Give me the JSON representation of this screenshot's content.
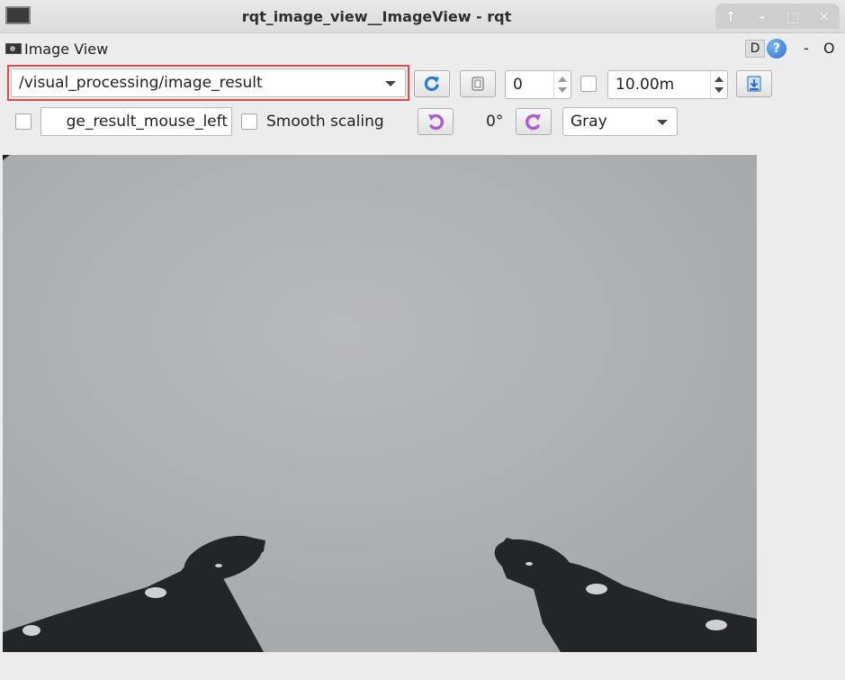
{
  "window": {
    "title": "rqt_image_view__ImageView - rqt",
    "buttons": [
      "↑",
      "–",
      "□",
      "✕"
    ]
  },
  "plugin": {
    "title": "Image View",
    "d_label": "D",
    "help_label": "?",
    "dash_label": "-",
    "close_label": "O"
  },
  "toolbar": {
    "topic": "/visual_processing/image_result",
    "spin_value": "0",
    "dynamic_range_value": "10.00m",
    "mouse_topic": "ge_result_mouse_left",
    "smooth_scaling_label": "Smooth scaling",
    "rotation": "0°",
    "color_scheme": "Gray"
  },
  "colors": {
    "highlight": "#e04a4a",
    "refresh_icon": "#2a7ad8",
    "rotate_icon": "#b05ad0"
  }
}
